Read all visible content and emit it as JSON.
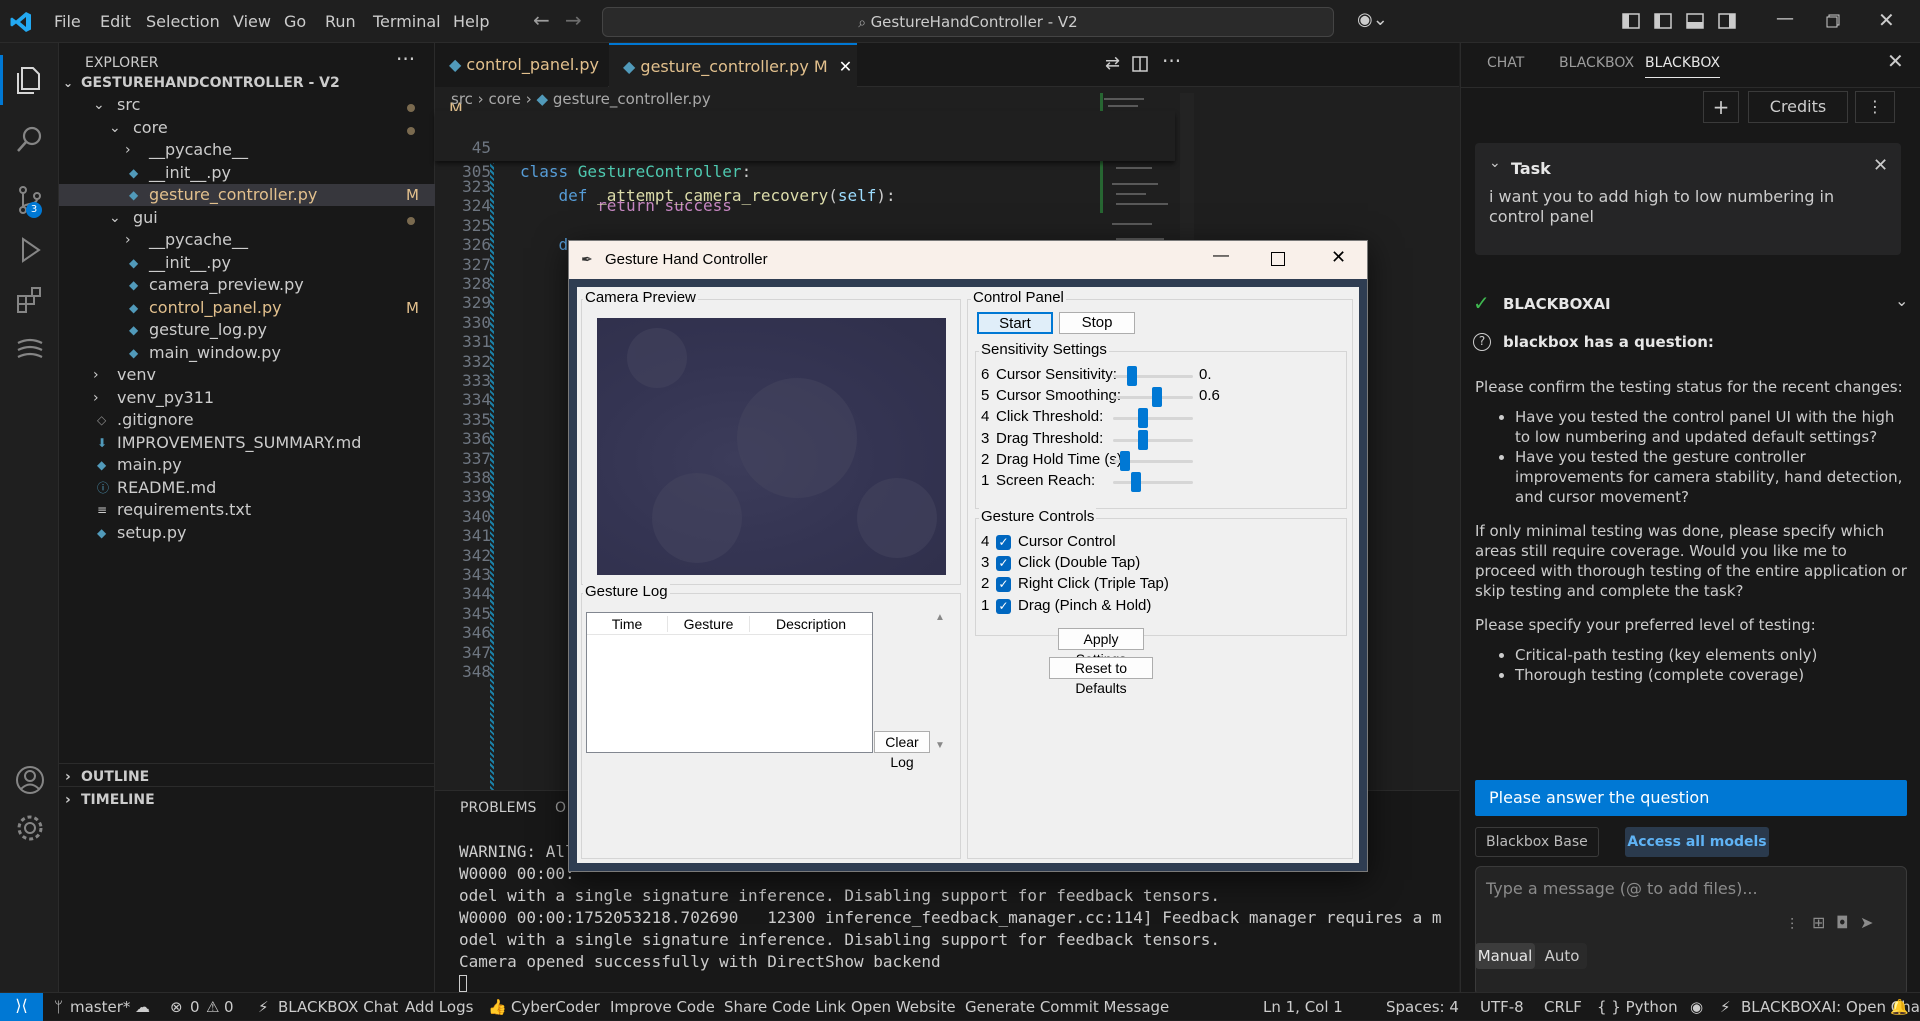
{
  "menu": [
    "File",
    "Edit",
    "Selection",
    "View",
    "Go",
    "Run",
    "Terminal",
    "Help"
  ],
  "command_center": "GestureHandController - V2",
  "explorer": {
    "title": "EXPLORER",
    "root": "GESTUREHANDCONTROLLER - V2",
    "items": [
      {
        "label": "src",
        "indent": 1,
        "type": "folder-open"
      },
      {
        "label": "core",
        "indent": 2,
        "type": "folder-open"
      },
      {
        "label": "__pycache__",
        "indent": 3,
        "type": "folder"
      },
      {
        "label": "__init__.py",
        "indent": 3,
        "type": "py"
      },
      {
        "label": "gesture_controller.py",
        "indent": 3,
        "type": "py",
        "badge": "M"
      },
      {
        "label": "gui",
        "indent": 2,
        "type": "folder-open"
      },
      {
        "label": "__pycache__",
        "indent": 3,
        "type": "folder"
      },
      {
        "label": "__init__.py",
        "indent": 3,
        "type": "py"
      },
      {
        "label": "camera_preview.py",
        "indent": 3,
        "type": "py"
      },
      {
        "label": "control_panel.py",
        "indent": 3,
        "type": "py",
        "badge": "M"
      },
      {
        "label": "gesture_log.py",
        "indent": 3,
        "type": "py"
      },
      {
        "label": "main_window.py",
        "indent": 3,
        "type": "py"
      },
      {
        "label": "venv",
        "indent": 1,
        "type": "folder"
      },
      {
        "label": "venv_py311",
        "indent": 1,
        "type": "folder"
      },
      {
        "label": ".gitignore",
        "indent": 1,
        "type": "git"
      },
      {
        "label": "IMPROVEMENTS_SUMMARY.md",
        "indent": 1,
        "type": "md-down"
      },
      {
        "label": "main.py",
        "indent": 1,
        "type": "py"
      },
      {
        "label": "README.md",
        "indent": 1,
        "type": "info"
      },
      {
        "label": "requirements.txt",
        "indent": 1,
        "type": "txt"
      },
      {
        "label": "setup.py",
        "indent": 1,
        "type": "py"
      }
    ],
    "outline": "OUTLINE",
    "timeline": "TIMELINE"
  },
  "tabs": [
    {
      "label": "control_panel.py",
      "badge": "M"
    },
    {
      "label": "gesture_controller.py",
      "badge": "M"
    }
  ],
  "breadcrumb": [
    "src",
    "core",
    "gesture_controller.py"
  ],
  "sticky": [
    {
      "ln": "45",
      "code": "class GestureController:"
    },
    {
      "ln": "305",
      "code": "    def _attempt_camera_recovery(self):"
    }
  ],
  "code_lines": [
    {
      "ln": "323",
      "code": ""
    },
    {
      "ln": "324",
      "code": "        return success"
    },
    {
      "ln": "325",
      "code": ""
    },
    {
      "ln": "326",
      "code": "    d"
    },
    {
      "ln": "327",
      "code": ""
    },
    {
      "ln": "328",
      "code": ""
    },
    {
      "ln": "329",
      "code": ""
    },
    {
      "ln": "330",
      "code": ""
    },
    {
      "ln": "331",
      "code": ""
    },
    {
      "ln": "332",
      "code": ""
    },
    {
      "ln": "333",
      "code": ""
    },
    {
      "ln": "334",
      "code": ""
    },
    {
      "ln": "335",
      "code": ""
    },
    {
      "ln": "336",
      "code": ""
    },
    {
      "ln": "337",
      "code": ""
    },
    {
      "ln": "338",
      "code": ""
    },
    {
      "ln": "339",
      "code": ""
    },
    {
      "ln": "340",
      "code": ""
    },
    {
      "ln": "341",
      "code": ""
    },
    {
      "ln": "342",
      "code": ""
    },
    {
      "ln": "343",
      "code": ""
    },
    {
      "ln": "344",
      "code": ""
    },
    {
      "ln": "345",
      "code": ""
    },
    {
      "ln": "346",
      "code": ""
    },
    {
      "ln": "347",
      "code": ""
    },
    {
      "ln": "348",
      "code": ""
    }
  ],
  "panel": {
    "tabs": [
      "PROBLEMS",
      "O"
    ],
    "lines": [
      "WARNING: All",
      "W0000 00:00:",
      "odel with a single signature inference. Disabling support for feedback tensors.",
      "W0000 00:00:1752053218.702690   12300 inference_feedback_manager.cc:114] Feedback manager requires a m",
      "odel with a single signature inference. Disabling support for feedback tensors.",
      "Camera opened successfully with DirectShow backend"
    ]
  },
  "tk": {
    "title": "Gesture Hand Controller",
    "camera_preview": "Camera Preview",
    "control_panel": "Control Panel",
    "start": "Start",
    "stop": "Stop",
    "sensitivity_title": "Sensitivity Settings",
    "sliders": [
      {
        "num": "6",
        "label": "Cursor Sensitivity:",
        "value_text": "0.",
        "level": 0.2
      },
      {
        "num": "5",
        "label": "Cursor Smoothing:",
        "value_text": "0.6",
        "level": 0.55
      },
      {
        "num": "4",
        "label": "Click Threshold:",
        "value_text": "",
        "level": 0.35
      },
      {
        "num": "3",
        "label": "Drag Threshold:",
        "value_text": "",
        "level": 0.35
      },
      {
        "num": "2",
        "label": "Drag Hold Time (s):",
        "value_text": "",
        "level": 0.1
      },
      {
        "num": "1",
        "label": "Screen Reach:",
        "value_text": "",
        "level": 0.25
      }
    ],
    "gesture_controls_title": "Gesture Controls",
    "checks": [
      {
        "num": "4",
        "label": "Cursor Control",
        "checked": true
      },
      {
        "num": "3",
        "label": "Click (Double Tap)",
        "checked": true
      },
      {
        "num": "2",
        "label": "Right Click (Triple Tap)",
        "checked": true
      },
      {
        "num": "1",
        "label": "Drag (Pinch & Hold)",
        "checked": true
      }
    ],
    "apply": "Apply Settings",
    "reset": "Reset to Defaults",
    "gesture_log": "Gesture Log",
    "log_columns": [
      "Time",
      "Gesture",
      "Description"
    ],
    "clear_log": "Clear Log"
  },
  "chat": {
    "tabs": [
      "CHAT",
      "BLACKBOX",
      "BLACKBOX"
    ],
    "credits": "Credits",
    "task_title": "Task",
    "task_text": "i want you to add high to low numbering in control panel",
    "agent": "BLACKBOXAI",
    "question_title": "blackbox has a question:",
    "p1": "Please confirm the testing status for the recent changes:",
    "bullets1": [
      "Have you tested the control panel UI with the high to low numbering and updated default settings?",
      "Have you tested the gesture controller improvements for camera stability, hand detection, and cursor movement?"
    ],
    "p2": "If only minimal testing was done, please specify which areas still require coverage. Would you like me to proceed with thorough testing of the entire application or skip testing and complete the task?",
    "p3": "Please specify your preferred level of testing:",
    "bullets2": [
      "Critical-path testing (key elements only)",
      "Thorough testing (complete coverage)"
    ],
    "answer_banner": "Please answer the question",
    "model": "Blackbox Base",
    "access": "Access all models",
    "input_placeholder": "Type a message (@ to add files)...",
    "mode_manual": "Manual",
    "mode_auto": "Auto"
  },
  "status": {
    "branch": "master*",
    "errors": "0",
    "warnings": "0",
    "items": [
      "BLACKBOX Chat",
      "Add Logs",
      "CyberCoder",
      "Improve Code",
      "Share Code Link",
      "Open Website",
      "Generate Commit Message"
    ],
    "position": "Ln 1, Col 1",
    "spaces": "Spaces: 4",
    "encoding": "UTF-8",
    "eol": "CRLF",
    "language": "{ } Python",
    "open_chat": "BLACKBOXAI: Open Chat"
  },
  "colors": {
    "accent": "#0078d4",
    "modified": "#e2c08d",
    "keyword": "#569cd6",
    "class": "#4ec9b0",
    "func": "#dcdcaa",
    "control": "#c586c0"
  }
}
